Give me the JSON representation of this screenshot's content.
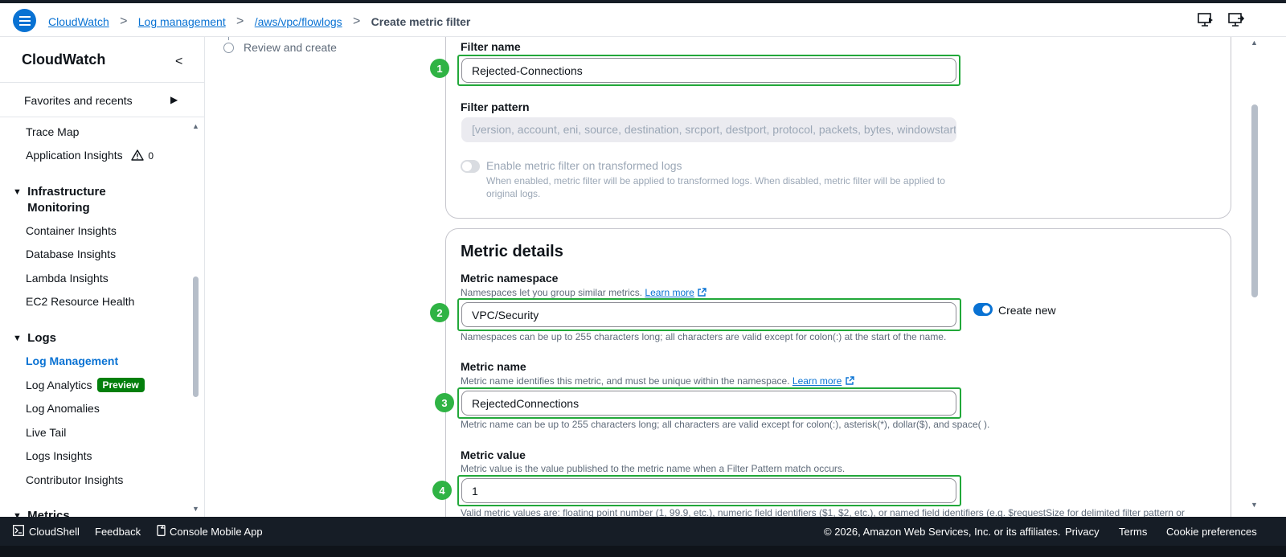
{
  "breadcrumb": {
    "items": [
      "CloudWatch",
      "Log management",
      "/aws/vpc/flowlogs"
    ],
    "current": "Create metric filter",
    "separator": ">"
  },
  "sidebar": {
    "title": "CloudWatch",
    "collapse_glyph": "<",
    "favorites": "Favorites and recents",
    "items_top": [
      "Trace Map",
      "Application Insights"
    ],
    "app_insights_warning_count": "0",
    "sections": {
      "infrastructure": "Infrastructure Monitoring",
      "logs": "Logs",
      "metrics": "Metrics"
    },
    "infrastructure_items": [
      "Container Insights",
      "Database Insights",
      "Lambda Insights",
      "EC2 Resource Health"
    ],
    "logs_items": [
      "Log Management",
      "Log Analytics",
      "Log Anomalies",
      "Live Tail",
      "Logs Insights",
      "Contributor Insights"
    ],
    "preview_badge": "Preview"
  },
  "wizard": {
    "step_label": "Review and create"
  },
  "filter": {
    "name_label": "Filter name",
    "name_value": "Rejected-Connections",
    "pattern_label": "Filter pattern",
    "pattern_value": "[version, account, eni, source, destination, srcport, destport, protocol, packets, bytes, windowstart, windowend, action, flowlogstatus]",
    "transform_toggle_label": "Enable metric filter on transformed logs",
    "transform_toggle_desc": "When enabled, metric filter will be applied to transformed logs. When disabled, metric filter will be applied to original logs."
  },
  "metric": {
    "section_title": "Metric details",
    "namespace_label": "Metric namespace",
    "namespace_desc": "Namespaces let you group similar metrics.",
    "learn_more": "Learn more",
    "namespace_value": "VPC/Security",
    "create_new_label": "Create new",
    "namespace_constraint": "Namespaces can be up to 255 characters long; all characters are valid except for colon(:) at the start of the name.",
    "name_label": "Metric name",
    "name_desc": "Metric name identifies this metric, and must be unique within the namespace.",
    "name_value": "RejectedConnections",
    "name_constraint": "Metric name can be up to 255 characters long; all characters are valid except for colon(:), asterisk(*), dollar($), and space( ).",
    "value_label": "Metric value",
    "value_desc": "Metric value is the value published to the metric name when a Filter Pattern match occurs.",
    "value_value": "1",
    "value_constraint": "Valid metric values are: floating point number (1, 99.9, etc.), numeric field identifiers ($1, $2, etc.), or named field identifiers (e.g. $requestSize for delimited filter pattern or"
  },
  "annotations": [
    "1",
    "2",
    "3",
    "4"
  ],
  "footer": {
    "cloudshell": "CloudShell",
    "feedback": "Feedback",
    "mobile_app": "Console Mobile App",
    "copyright": "© 2026, Amazon Web Services, Inc. or its affiliates.",
    "privacy": "Privacy",
    "terms": "Terms",
    "cookie": "Cookie preferences"
  },
  "colors": {
    "accent": "#0972d3",
    "highlight": "#22a83a",
    "footer_bg": "#161d26",
    "preview_badge": "#037f0c"
  }
}
